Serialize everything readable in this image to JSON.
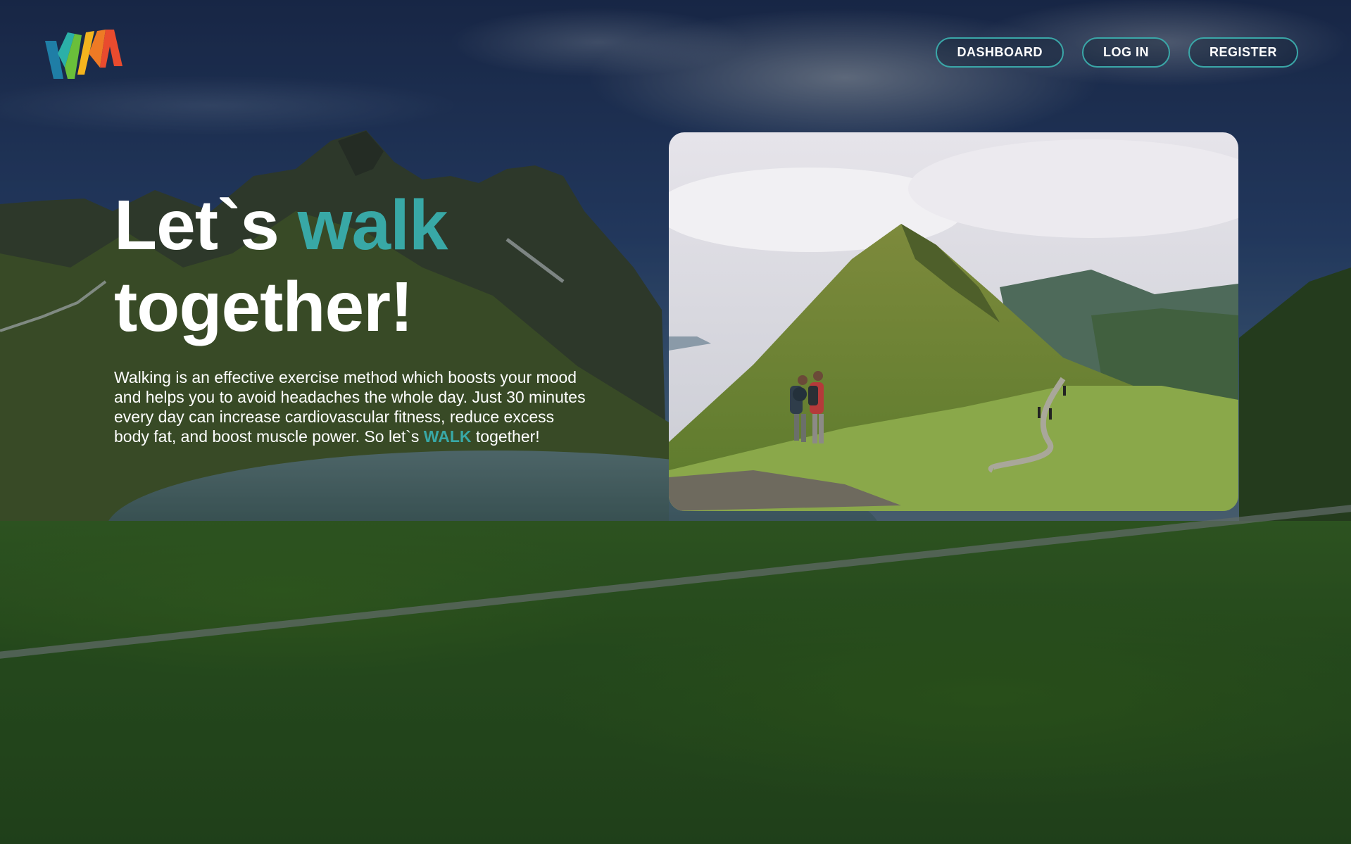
{
  "nav": {
    "dashboard": "DASHBOARD",
    "login": "LOG IN",
    "register": "REGISTER"
  },
  "hero": {
    "headline_part1": "Let`s ",
    "headline_accent": "walk",
    "headline_part2": "together!",
    "intro_text": "Walking is an effective exercise method which boosts your mood and helps you to avoid headaches the whole day. Just 30 minutes every day can increase cardiovascular fitness, reduce excess body fat, and boost muscle power. So let`s ",
    "intro_accent": "WALK",
    "intro_end": " together!"
  },
  "colors": {
    "accent": "#38a8a6",
    "button_border": "#3aa7a8",
    "text": "#ffffff"
  },
  "icons": {
    "logo": "wm-logo-icon"
  }
}
